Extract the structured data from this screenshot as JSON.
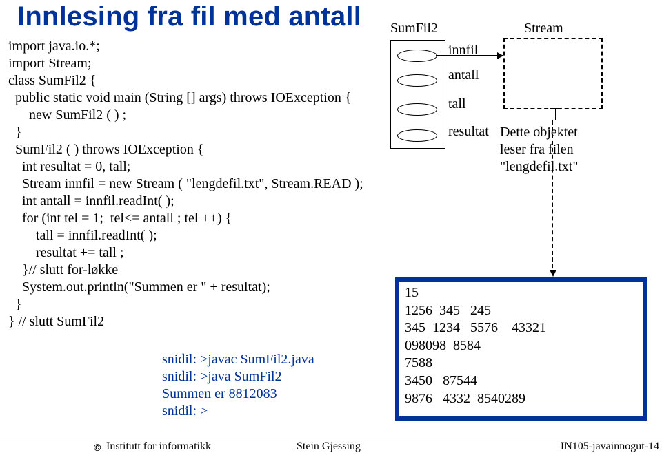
{
  "title": "Innlesing fra fil med antall",
  "code": "import java.io.*;\nimport Stream;\nclass SumFil2 {\n  public static void main (String [] args) throws IOException {\n      new SumFil2 ( ) ;\n  }\n  SumFil2 ( ) throws IOException {\n    int resultat = 0, tall;\n    Stream innfil = new Stream ( \"lengdefil.txt\", Stream.READ );\n    int antall = innfil.readInt( );\n    for (int tel = 1;  tel<= antall ; tel ++) {\n        tall = innfil.readInt( );\n        resultat += tall ;\n    }// slutt for-løkke\n    System.out.println(\"Summen er \" + resultat);\n  }\n} // slutt SumFil2",
  "console": "snidil: >javac SumFil2.java\nsnidil: >java SumFil2\nSummen er 8812083\nsnidil: >",
  "labels": {
    "sumfil2": "SumFil2",
    "stream": "Stream",
    "innfil": "innfil",
    "antall": "antall",
    "tall": "tall",
    "resultat": "resultat"
  },
  "obj_text": "Dette objektet\nleser fra filen\n\"lengdefil.txt\"",
  "file_contents": "15\n1256  345   245\n345  1234   5576    43321\n098098  8584\n7588\n3450   87544\n9876   4332  8540289",
  "footer": {
    "copyright": "©",
    "left": "Institutt for informatikk",
    "mid": "Stein Gjessing",
    "right": "IN105-javainnogut-14"
  }
}
